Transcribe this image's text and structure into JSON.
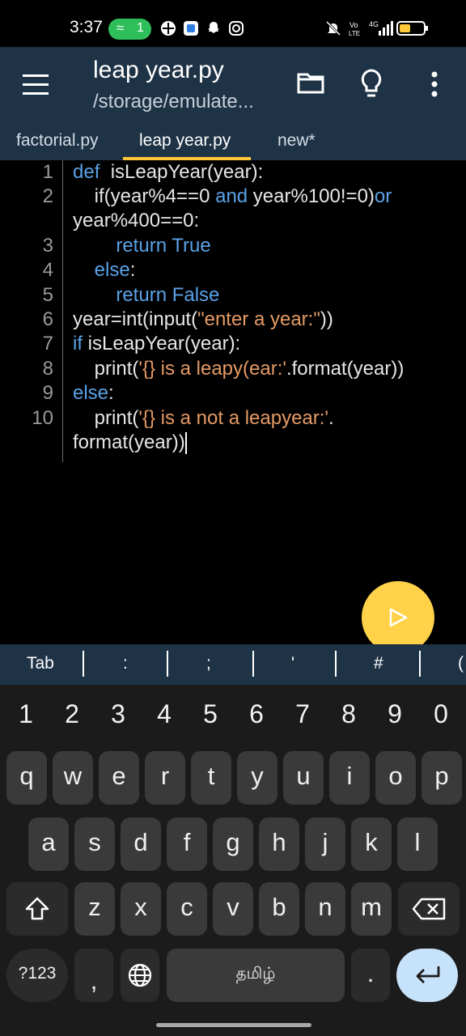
{
  "status": {
    "time": "3:37",
    "hotspot_count": "1",
    "icons": [
      "grid-icon",
      "blue-app-icon",
      "snapchat-icon",
      "instagram-icon",
      "mute-icon",
      "volte-icon",
      "signal-4g-icon",
      "battery-icon"
    ]
  },
  "appbar": {
    "title": "leap year.py",
    "subtitle": "/storage/emulate..."
  },
  "tabs": [
    {
      "label": "factorial.py"
    },
    {
      "label": "leap year.py",
      "active": true
    },
    {
      "label": "new*"
    }
  ],
  "editor": {
    "line_numbers": [
      "1",
      "2",
      "3",
      "4",
      "5",
      "6",
      "7",
      "8",
      "9",
      "10"
    ],
    "lines": [
      {
        "parts": [
          {
            "t": "def ",
            "kw": true
          },
          {
            "t": " isLeapYear(year):"
          }
        ]
      },
      {
        "parts": [
          {
            "t": "    if(year%4==0 "
          },
          {
            "t": "and",
            "kw": true
          },
          {
            "t": " year%100!=0)"
          },
          {
            "t": "or",
            "kw": true
          }
        ]
      },
      {
        "parts": [
          {
            "t": "year%400==0:"
          }
        ]
      },
      {
        "parts": [
          {
            "t": "        "
          },
          {
            "t": "return True",
            "kw": true
          }
        ]
      },
      {
        "parts": [
          {
            "t": "    "
          },
          {
            "t": "else",
            "kw": true
          },
          {
            "t": ":"
          }
        ]
      },
      {
        "parts": [
          {
            "t": "        "
          },
          {
            "t": "return False",
            "kw": true
          }
        ]
      },
      {
        "parts": [
          {
            "t": "year=int(input("
          },
          {
            "t": "\"enter a year:\"",
            "str": true
          },
          {
            "t": "))"
          }
        ]
      },
      {
        "parts": [
          {
            "t": "if",
            "kw": true
          },
          {
            "t": " isLeapYear(year):"
          }
        ]
      },
      {
        "parts": [
          {
            "t": "    print("
          },
          {
            "t": "'{} is a leapy(ear:'",
            "str": true
          },
          {
            "t": ".format(year))"
          }
        ]
      },
      {
        "parts": [
          {
            "t": "else",
            "kw": true
          },
          {
            "t": ":"
          }
        ]
      },
      {
        "parts": [
          {
            "t": "    print("
          },
          {
            "t": "'{} is a not a leapyear:'",
            "str": true
          },
          {
            "t": "."
          }
        ]
      },
      {
        "parts": [
          {
            "t": "format(year))"
          }
        ]
      }
    ]
  },
  "extra_keys": [
    "Tab",
    ":",
    ";",
    "'",
    "#",
    "("
  ],
  "keyboard": {
    "numbers": [
      "1",
      "2",
      "3",
      "4",
      "5",
      "6",
      "7",
      "8",
      "9",
      "0"
    ],
    "row1": [
      "q",
      "w",
      "e",
      "r",
      "t",
      "y",
      "u",
      "i",
      "o",
      "p"
    ],
    "row2": [
      "a",
      "s",
      "d",
      "f",
      "g",
      "h",
      "j",
      "k",
      "l"
    ],
    "row3": [
      "z",
      "x",
      "c",
      "v",
      "b",
      "n",
      "m"
    ],
    "symbols_label": "?123",
    "comma": ",",
    "space_label": "தமிழ்",
    "period": "."
  },
  "colors": {
    "appbar": "#1f3346",
    "accent": "#ffc73a",
    "fab": "#ffd24a",
    "keyword": "#5aa2e6",
    "string": "#e59a65"
  }
}
